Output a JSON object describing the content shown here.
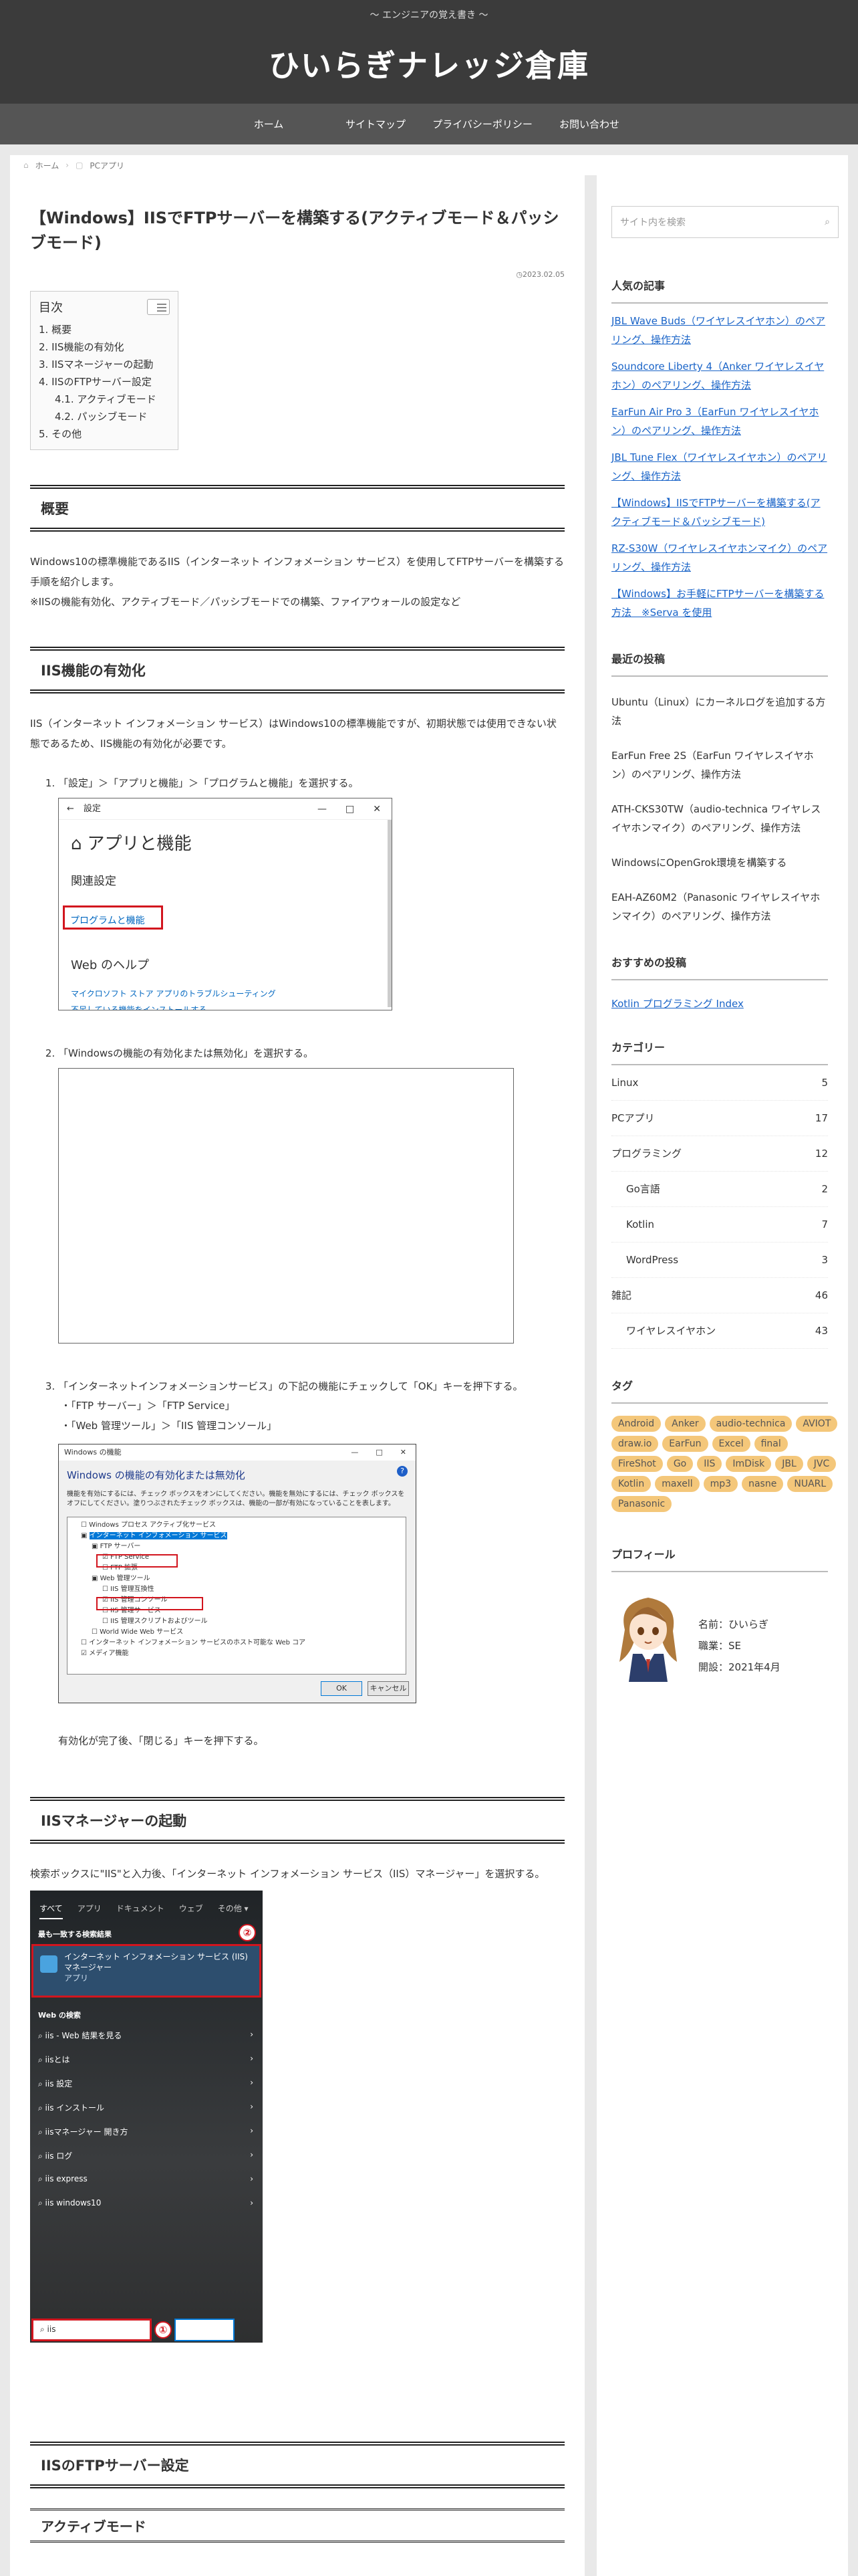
{
  "header": {
    "tagline": "～ エンジニアの覚え書き ～",
    "title": "ひいらぎナレッジ倉庫"
  },
  "nav": [
    "ホーム",
    "サイトマップ",
    "プライバシーポリシー",
    "お問い合わせ"
  ],
  "breadcrumb": {
    "home": "ホーム",
    "category": "PCアプリ"
  },
  "post": {
    "title": "【Windows】IISでFTPサーバーを構築する(アクティブモード＆パッシブモード)",
    "date": "2023.02.05",
    "toc": {
      "title": "目次",
      "items": [
        "1. 概要",
        "2. IIS機能の有効化",
        "3. IISマネージャーの起動",
        "4. IISのFTPサーバー設定",
        "4.1. アクティブモード",
        "4.2. パッシブモード",
        "5. その他"
      ]
    },
    "sections": {
      "overview": "概要",
      "overview_p1": "Windows10の標準機能であるIIS（インターネット インフォメーション サービス）を使用してFTPサーバーを構築する手順を紹介します。",
      "overview_p2": "※IISの機能有効化、アクティブモード／パッシブモードでの構築、ファイアウォールの設定など",
      "enable": "IIS機能の有効化",
      "enable_p": "IIS（インターネット インフォメーション サービス）はWindows10の標準機能ですが、初期状態では使用できない状態であるため、IIS機能の有効化が必要です。",
      "step1": "「設定」＞「アプリと機能」＞「プログラムと機能」を選択する。",
      "step2": "「Windowsの機能の有効化または無効化」を選択する。",
      "step3": "「インターネットインフォメーションサービス」の下記の機能にチェックして「OK」キーを押下する。",
      "bullet1": "・「FTP サーバー」＞「FTP Service」",
      "bullet2": "・「Web 管理ツール」＞「IIS 管理コンソール」",
      "step3_after": "有効化が完了後、「閉じる」キーを押下する。",
      "manager": "IISマネージャーの起動",
      "manager_p": "検索ボックスに\"IIS\"と入力後、「インターネット インフォメーション サービス（IIS）マネージャー」を選択する。",
      "ftp": "IISのFTPサーバー設定",
      "active": "アクティブモード"
    },
    "shot1": {
      "back": "←",
      "title": "設定",
      "controls": [
        "—",
        "□",
        "✕"
      ],
      "heading": "アプリと機能",
      "related": "関連設定",
      "link": "プログラムと機能",
      "web_help": "Web のヘルプ",
      "link2": "マイクロソフト ストア アプリのトラブルシューティング",
      "link3": "不足している機能をインストールする"
    },
    "shot3": {
      "title": "Windows の機能",
      "controls": [
        "—",
        "□",
        "✕"
      ],
      "heading": "Windows の機能の有効化または無効化",
      "help": "?",
      "desc": "機能を有効にするには、チェック ボックスをオンにしてください。機能を無効にするには、チェック ボックスをオフにしてください。塗りつぶされたチェック ボックスは、機能の一部が有効になっていることを表します。",
      "tree": [
        "Windows プロセス アクティブ化サービス",
        "インターネット インフォメーション サービス",
        "FTP サーバー",
        "FTP Service",
        "FTP 拡張",
        "Web 管理ツール",
        "IIS 管理互換性",
        "IIS 管理コンソール",
        "IIS 管理サービス",
        "IIS 管理スクリプトおよびツール",
        "World Wide Web サービス",
        "インターネット インフォメーション サービスのホスト可能な Web コア",
        "メディア機能"
      ],
      "ok": "OK",
      "cancel": "キャンセル"
    },
    "shot4": {
      "tabs": [
        "すべて",
        "アプリ",
        "ドキュメント",
        "ウェブ",
        "その他 ▾"
      ],
      "best": "最も一致する検索結果",
      "result_title": "インターネット インフォメーション サービス (IIS) マネージャー",
      "result_type": "アプリ",
      "web": "Web の検索",
      "rows": [
        "iis - Web 結果を見る",
        "iisとは",
        "iis 設定",
        "iis インストール",
        "iisマネージャー 開き方",
        "iis ログ",
        "iis express",
        "iis windows10"
      ],
      "query": "iis",
      "badge1": "①",
      "badge2": "②"
    }
  },
  "sidebar": {
    "search_placeholder": "サイト内を検索",
    "popular_title": "人気の記事",
    "popular": [
      "JBL Wave Buds（ワイヤレスイヤホン）のペアリング、操作方法",
      "Soundcore Liberty 4（Anker ワイヤレスイヤホン）のペアリング、操作方法",
      "EarFun Air Pro 3（EarFun ワイヤレスイヤホン）のペアリング、操作方法",
      "JBL Tune Flex（ワイヤレスイヤホン）のペアリング、操作方法",
      "【Windows】IISでFTPサーバーを構築する(アクティブモード＆パッシブモード)",
      "RZ-S30W（ワイヤレスイヤホンマイク）のペアリング、操作方法",
      "【Windows】お手軽にFTPサーバーを構築する方法　※Serva を使用"
    ],
    "recent_title": "最近の投稿",
    "recent": [
      "Ubuntu（Linux）にカーネルログを追加する方法",
      "EarFun Free 2S（EarFun ワイヤレスイヤホン）のペアリング、操作方法",
      "ATH-CKS30TW（audio-technica ワイヤレスイヤホンマイク）のペアリング、操作方法",
      "WindowsにOpenGrok環境を構築する",
      "EAH-AZ60M2（Panasonic ワイヤレスイヤホンマイク）のペアリング、操作方法"
    ],
    "recommend_title": "おすすめの投稿",
    "recommend": "Kotlin プログラミング Index",
    "category_title": "カテゴリー",
    "categories": [
      {
        "name": "Linux",
        "count": "5",
        "child": false
      },
      {
        "name": "PCアプリ",
        "count": "17",
        "child": false
      },
      {
        "name": "プログラミング",
        "count": "12",
        "child": false
      },
      {
        "name": "Go言語",
        "count": "2",
        "child": true
      },
      {
        "name": "Kotlin",
        "count": "7",
        "child": true
      },
      {
        "name": "WordPress",
        "count": "3",
        "child": true
      },
      {
        "name": "雑記",
        "count": "46",
        "child": false
      },
      {
        "name": "ワイヤレスイヤホン",
        "count": "43",
        "child": true
      }
    ],
    "tag_title": "タグ",
    "tags": [
      "Android",
      "Anker",
      "audio-technica",
      "AVIOT",
      "draw.io",
      "EarFun",
      "Excel",
      "final",
      "FireShot",
      "Go",
      "IIS",
      "ImDisk",
      "JBL",
      "JVC",
      "Kotlin",
      "maxell",
      "mp3",
      "nasne",
      "NUARL",
      "Panasonic"
    ],
    "profile_title": "プロフィール",
    "profile": {
      "name": "名前：ひいらぎ",
      "job": "職業：SE",
      "start": "開設：2021年4月"
    }
  },
  "colors": {
    "header": "#3b3b3b",
    "nav": "#555555",
    "link": "#1a64c8",
    "tag": "#f4c77a",
    "highlight_red": "#d2151e"
  }
}
